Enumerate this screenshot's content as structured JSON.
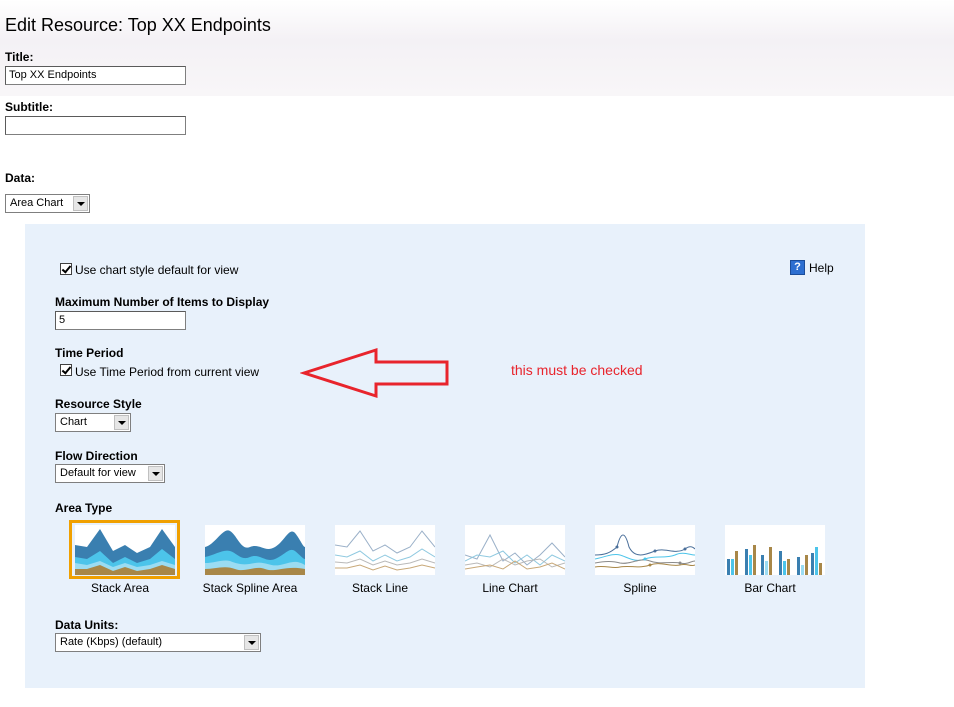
{
  "header": {
    "title": "Edit Resource: Top XX Endpoints"
  },
  "form": {
    "title_label": "Title:",
    "title_value": "Top XX Endpoints",
    "subtitle_label": "Subtitle:",
    "subtitle_value": "",
    "data_label": "Data:",
    "data_value": "Area Chart"
  },
  "panel": {
    "use_default_label": "Use chart style default for view",
    "use_default_checked": true,
    "help_label": "Help",
    "max_items_label": "Maximum Number of Items to Display",
    "max_items_value": "5",
    "time_period_label": "Time Period",
    "time_period_checkbox_label": "Use Time Period from current view",
    "time_period_checked": true,
    "resource_style_label": "Resource Style",
    "resource_style_value": "Chart",
    "flow_direction_label": "Flow Direction",
    "flow_direction_value": "Default for view",
    "area_type_label": "Area Type",
    "area_types": [
      {
        "label": "Stack Area",
        "selected": true,
        "icon": "stack-area-thumbnail"
      },
      {
        "label": "Stack Spline Area",
        "selected": false,
        "icon": "stack-spline-area-thumbnail"
      },
      {
        "label": "Stack Line",
        "selected": false,
        "icon": "stack-line-thumbnail"
      },
      {
        "label": "Line Chart",
        "selected": false,
        "icon": "line-chart-thumbnail"
      },
      {
        "label": "Spline",
        "selected": false,
        "icon": "spline-thumbnail"
      },
      {
        "label": "Bar Chart",
        "selected": false,
        "icon": "bar-chart-thumbnail"
      }
    ],
    "data_units_label": "Data Units:",
    "data_units_value": "Rate (Kbps) (default)"
  },
  "annotation": {
    "text": "this must be checked",
    "color": "#e8242c"
  },
  "colors": {
    "panel_bg": "#e8f1fb",
    "selection_border": "#f0a000",
    "area_dark": "#3a7fb0",
    "area_mid": "#4cc4ea",
    "area_light": "#9bdcf2",
    "area_brown": "#a88748"
  }
}
